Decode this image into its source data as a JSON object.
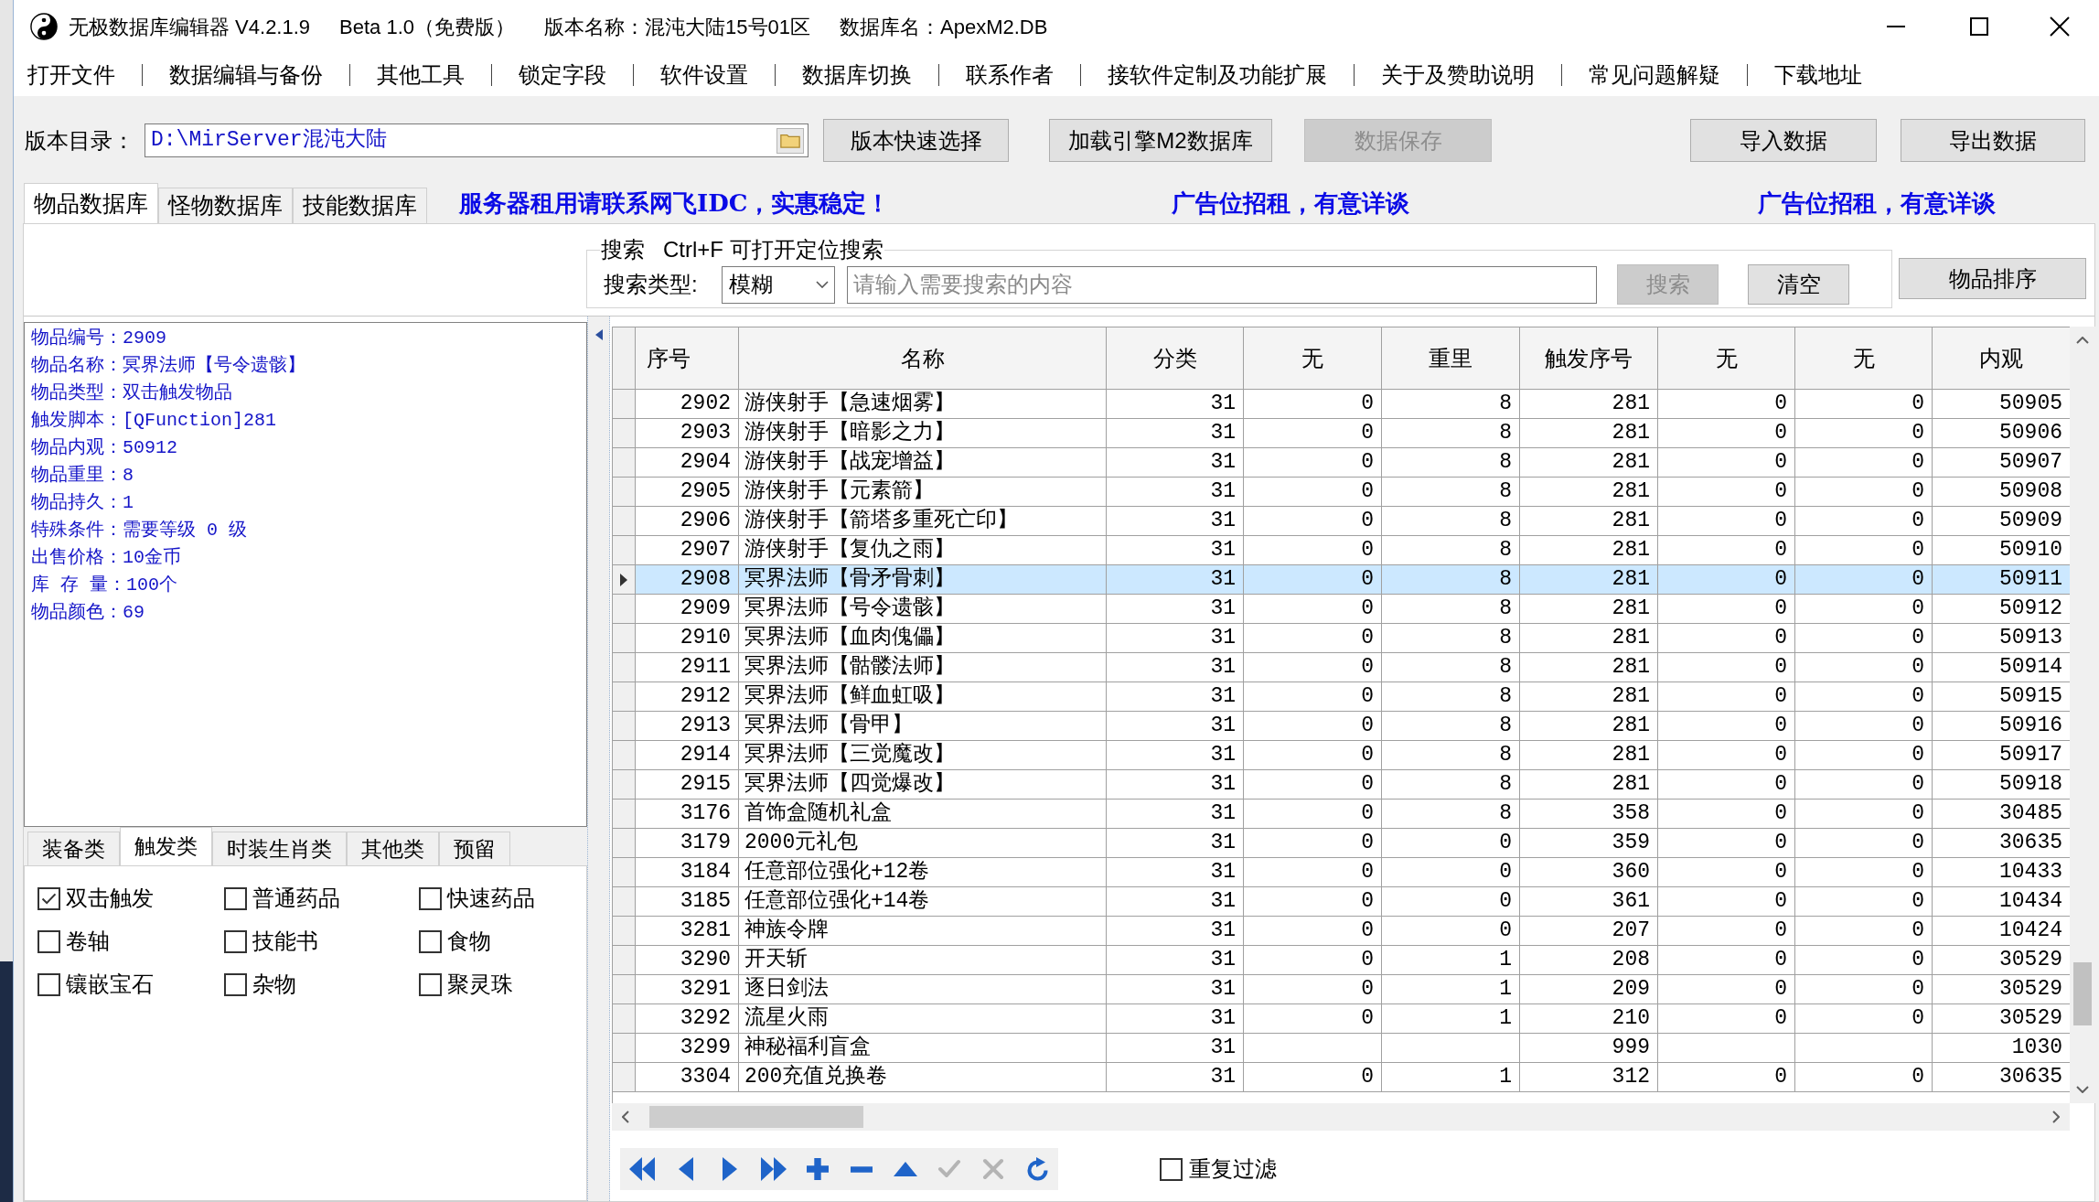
{
  "window": {
    "title_parts": [
      "无极数据库编辑器 V4.2.1.9",
      "Beta 1.0（免费版）",
      "版本名称：混沌大陆15号01区",
      "数据库名：ApexM2.DB"
    ]
  },
  "menu": [
    "打开文件",
    "数据编辑与备份",
    "其他工具",
    "锁定字段",
    "软件设置",
    "数据库切换",
    "联系作者",
    "接软件定制及功能扩展",
    "关于及赞助说明",
    "常见问题解疑",
    "下载地址"
  ],
  "path_bar": {
    "label": "版本目录：",
    "value": "D:\\MirServer混沌大陆"
  },
  "toolbar_buttons": [
    {
      "label": "版本快速选择",
      "disabled": false
    },
    {
      "label": "加载引擎M2数据库",
      "disabled": false
    },
    {
      "label": "数据保存",
      "disabled": true
    },
    {
      "label": "导入数据",
      "disabled": false
    },
    {
      "label": "导出数据",
      "disabled": false
    }
  ],
  "tabs": [
    {
      "label": "物品数据库",
      "selected": true
    },
    {
      "label": "怪物数据库",
      "selected": false
    },
    {
      "label": "技能数据库",
      "selected": false
    }
  ],
  "ads": [
    "服务器租用请联系网飞IDC，实惠稳定！",
    "广告位招租，有意详谈",
    "广告位招租，有意详谈"
  ],
  "search": {
    "title": "搜索   Ctrl+F 可打开定位搜索",
    "type_label": "搜索类型:",
    "type_value": "模糊",
    "placeholder": "请输入需要搜索的内容",
    "buttons": [
      {
        "label": "搜索",
        "disabled": true
      },
      {
        "label": "清空",
        "disabled": false
      }
    ]
  },
  "sort_button": {
    "label": "物品排序"
  },
  "item_details": [
    "物品编号：2909",
    "物品名称：冥界法师【号令遗骸】",
    "物品类型：双击触发物品",
    "触发脚本：[QFunction]281",
    "物品内观：50912",
    "物品重里：8",
    "物品持久：1",
    "特殊条件：需要等级 0 级",
    "出售价格：10金币",
    "库 存 量：100个",
    "物品颜色：69"
  ],
  "category_tabs": [
    {
      "label": "装备类",
      "selected": false
    },
    {
      "label": "触发类",
      "selected": true
    },
    {
      "label": "时装生肖类",
      "selected": false
    },
    {
      "label": "其他类",
      "selected": false
    },
    {
      "label": "预留",
      "selected": false
    }
  ],
  "category_options": [
    {
      "label": "双击触发",
      "checked": true
    },
    {
      "label": "普通药品",
      "checked": false
    },
    {
      "label": "快速药品",
      "checked": false
    },
    {
      "label": "卷轴",
      "checked": false
    },
    {
      "label": "技能书",
      "checked": false
    },
    {
      "label": "食物",
      "checked": false
    },
    {
      "label": "镶嵌宝石",
      "checked": false
    },
    {
      "label": "杂物",
      "checked": false
    },
    {
      "label": "聚灵珠",
      "checked": false
    }
  ],
  "table": {
    "columns": [
      "序号",
      "名称",
      "分类",
      "无",
      "重里",
      "触发序号",
      "无",
      "无",
      "内观"
    ],
    "rows": [
      {
        "selected": false,
        "seq": "2902",
        "name": "游侠射手【急速烟雾】",
        "category": "31",
        "column_4": "0",
        "weight": "8",
        "trigger_seq": "281",
        "column_7": "0",
        "column_8": "0",
        "appearance": "50905"
      },
      {
        "selected": false,
        "seq": "2903",
        "name": "游侠射手【暗影之力】",
        "category": "31",
        "column_4": "0",
        "weight": "8",
        "trigger_seq": "281",
        "column_7": "0",
        "column_8": "0",
        "appearance": "50906"
      },
      {
        "selected": false,
        "seq": "2904",
        "name": "游侠射手【战宠增益】",
        "category": "31",
        "column_4": "0",
        "weight": "8",
        "trigger_seq": "281",
        "column_7": "0",
        "column_8": "0",
        "appearance": "50907"
      },
      {
        "selected": false,
        "seq": "2905",
        "name": "游侠射手【元素箭】",
        "category": "31",
        "column_4": "0",
        "weight": "8",
        "trigger_seq": "281",
        "column_7": "0",
        "column_8": "0",
        "appearance": "50908"
      },
      {
        "selected": false,
        "seq": "2906",
        "name": "游侠射手【箭塔多重死亡印】",
        "category": "31",
        "column_4": "0",
        "weight": "8",
        "trigger_seq": "281",
        "column_7": "0",
        "column_8": "0",
        "appearance": "50909"
      },
      {
        "selected": false,
        "seq": "2907",
        "name": "游侠射手【复仇之雨】",
        "category": "31",
        "column_4": "0",
        "weight": "8",
        "trigger_seq": "281",
        "column_7": "0",
        "column_8": "0",
        "appearance": "50910"
      },
      {
        "selected": true,
        "seq": "2908",
        "name": "冥界法师【骨矛骨刺】",
        "category": "31",
        "column_4": "0",
        "weight": "8",
        "trigger_seq": "281",
        "column_7": "0",
        "column_8": "0",
        "appearance": "50911"
      },
      {
        "selected": false,
        "seq": "2909",
        "name": "冥界法师【号令遗骸】",
        "category": "31",
        "column_4": "0",
        "weight": "8",
        "trigger_seq": "281",
        "column_7": "0",
        "column_8": "0",
        "appearance": "50912"
      },
      {
        "selected": false,
        "seq": "2910",
        "name": "冥界法师【血肉傀儡】",
        "category": "31",
        "column_4": "0",
        "weight": "8",
        "trigger_seq": "281",
        "column_7": "0",
        "column_8": "0",
        "appearance": "50913"
      },
      {
        "selected": false,
        "seq": "2911",
        "name": "冥界法师【骷髅法师】",
        "category": "31",
        "column_4": "0",
        "weight": "8",
        "trigger_seq": "281",
        "column_7": "0",
        "column_8": "0",
        "appearance": "50914"
      },
      {
        "selected": false,
        "seq": "2912",
        "name": "冥界法师【鲜血虹吸】",
        "category": "31",
        "column_4": "0",
        "weight": "8",
        "trigger_seq": "281",
        "column_7": "0",
        "column_8": "0",
        "appearance": "50915"
      },
      {
        "selected": false,
        "seq": "2913",
        "name": "冥界法师【骨甲】",
        "category": "31",
        "column_4": "0",
        "weight": "8",
        "trigger_seq": "281",
        "column_7": "0",
        "column_8": "0",
        "appearance": "50916"
      },
      {
        "selected": false,
        "seq": "2914",
        "name": "冥界法师【三觉魔改】",
        "category": "31",
        "column_4": "0",
        "weight": "8",
        "trigger_seq": "281",
        "column_7": "0",
        "column_8": "0",
        "appearance": "50917"
      },
      {
        "selected": false,
        "seq": "2915",
        "name": "冥界法师【四觉爆改】",
        "category": "31",
        "column_4": "0",
        "weight": "8",
        "trigger_seq": "281",
        "column_7": "0",
        "column_8": "0",
        "appearance": "50918"
      },
      {
        "selected": false,
        "seq": "3176",
        "name": "首饰盒随机礼盒",
        "category": "31",
        "column_4": "0",
        "weight": "8",
        "trigger_seq": "358",
        "column_7": "0",
        "column_8": "0",
        "appearance": "30485"
      },
      {
        "selected": false,
        "seq": "3179",
        "name": "2000元礼包",
        "category": "31",
        "column_4": "0",
        "weight": "0",
        "trigger_seq": "359",
        "column_7": "0",
        "column_8": "0",
        "appearance": "30635"
      },
      {
        "selected": false,
        "seq": "3184",
        "name": "任意部位强化+12卷",
        "category": "31",
        "column_4": "0",
        "weight": "0",
        "trigger_seq": "360",
        "column_7": "0",
        "column_8": "0",
        "appearance": "10433"
      },
      {
        "selected": false,
        "seq": "3185",
        "name": "任意部位强化+14卷",
        "category": "31",
        "column_4": "0",
        "weight": "0",
        "trigger_seq": "361",
        "column_7": "0",
        "column_8": "0",
        "appearance": "10434"
      },
      {
        "selected": false,
        "seq": "3281",
        "name": "神族令牌",
        "category": "31",
        "column_4": "0",
        "weight": "0",
        "trigger_seq": "207",
        "column_7": "0",
        "column_8": "0",
        "appearance": "10424"
      },
      {
        "selected": false,
        "seq": "3290",
        "name": "开天斩",
        "category": "31",
        "column_4": "0",
        "weight": "1",
        "trigger_seq": "208",
        "column_7": "0",
        "column_8": "0",
        "appearance": "30529"
      },
      {
        "selected": false,
        "seq": "3291",
        "name": "逐日剑法",
        "category": "31",
        "column_4": "0",
        "weight": "1",
        "trigger_seq": "209",
        "column_7": "0",
        "column_8": "0",
        "appearance": "30529"
      },
      {
        "selected": false,
        "seq": "3292",
        "name": "流星火雨",
        "category": "31",
        "column_4": "0",
        "weight": "1",
        "trigger_seq": "210",
        "column_7": "0",
        "column_8": "0",
        "appearance": "30529"
      },
      {
        "selected": false,
        "seq": "3299",
        "name": "神秘福利盲盒",
        "category": "31",
        "trigger_seq": "999",
        "appearance": "1030"
      },
      {
        "selected": false,
        "seq": "3304",
        "name": "200充值兑换卷",
        "category": "31",
        "column_4": "0",
        "weight": "1",
        "trigger_seq": "312",
        "column_7": "0",
        "column_8": "0",
        "appearance": "30635"
      }
    ]
  },
  "navigator": [
    {
      "kind": "first",
      "disabled": false
    },
    {
      "kind": "prior",
      "disabled": false
    },
    {
      "kind": "next",
      "disabled": false
    },
    {
      "kind": "last",
      "disabled": false
    },
    {
      "kind": "insert",
      "disabled": false
    },
    {
      "kind": "delete",
      "disabled": false
    },
    {
      "kind": "edit",
      "disabled": false
    },
    {
      "kind": "post",
      "disabled": true
    },
    {
      "kind": "cancel",
      "disabled": true
    },
    {
      "kind": "refresh",
      "disabled": false
    }
  ],
  "repeat_filter": {
    "label": "重复过滤",
    "checked": false
  }
}
